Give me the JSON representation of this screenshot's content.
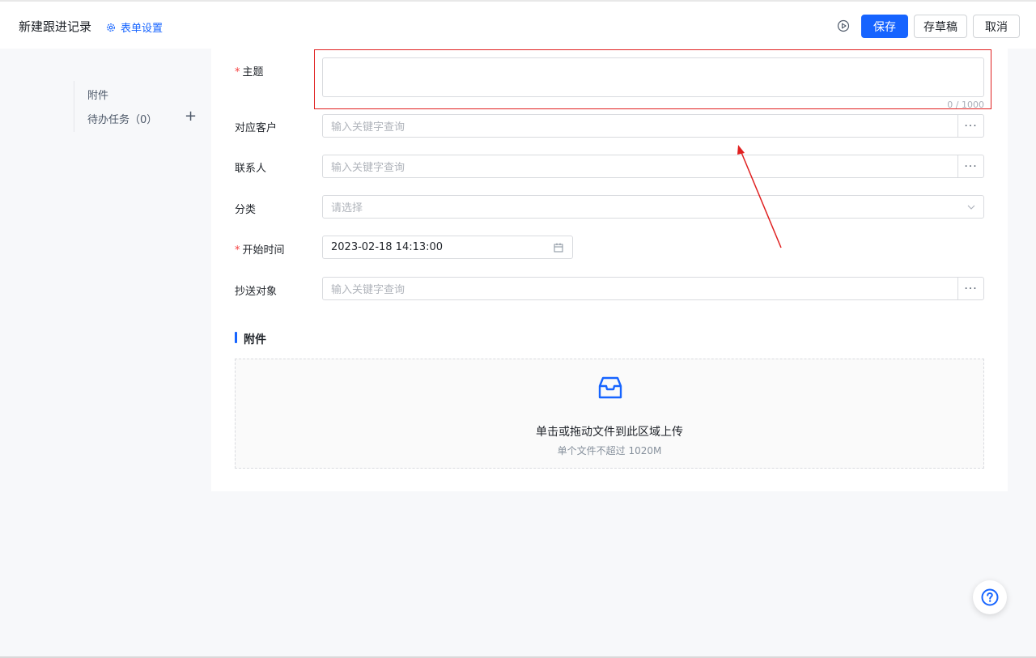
{
  "header": {
    "title": "新建跟进记录",
    "form_settings": "表单设置",
    "save": "保存",
    "draft": "存草稿",
    "cancel": "取消"
  },
  "sidenav": {
    "items": [
      {
        "label": "附件"
      },
      {
        "label": "待办任务（0）"
      }
    ],
    "add_symbol": "+"
  },
  "form": {
    "required_mark": "*",
    "subject": {
      "label": "主题",
      "value": "",
      "counter": "0 / 1000"
    },
    "customer": {
      "label": "对应客户",
      "placeholder": "输入关键字查询"
    },
    "contact": {
      "label": "联系人",
      "placeholder": "输入关键字查询"
    },
    "category": {
      "label": "分类",
      "placeholder": "请选择"
    },
    "start_time": {
      "label": "开始时间",
      "value": "2023-02-18 14:13:00"
    },
    "cc": {
      "label": "抄送对象",
      "placeholder": "输入关键字查询"
    },
    "more_symbol": "···"
  },
  "attachments": {
    "title": "附件",
    "drop_text": "单击或拖动文件到此区域上传",
    "drop_hint": "单个文件不超过 1020M"
  },
  "colors": {
    "accent": "#1664ff",
    "annotation": "#e02020"
  }
}
